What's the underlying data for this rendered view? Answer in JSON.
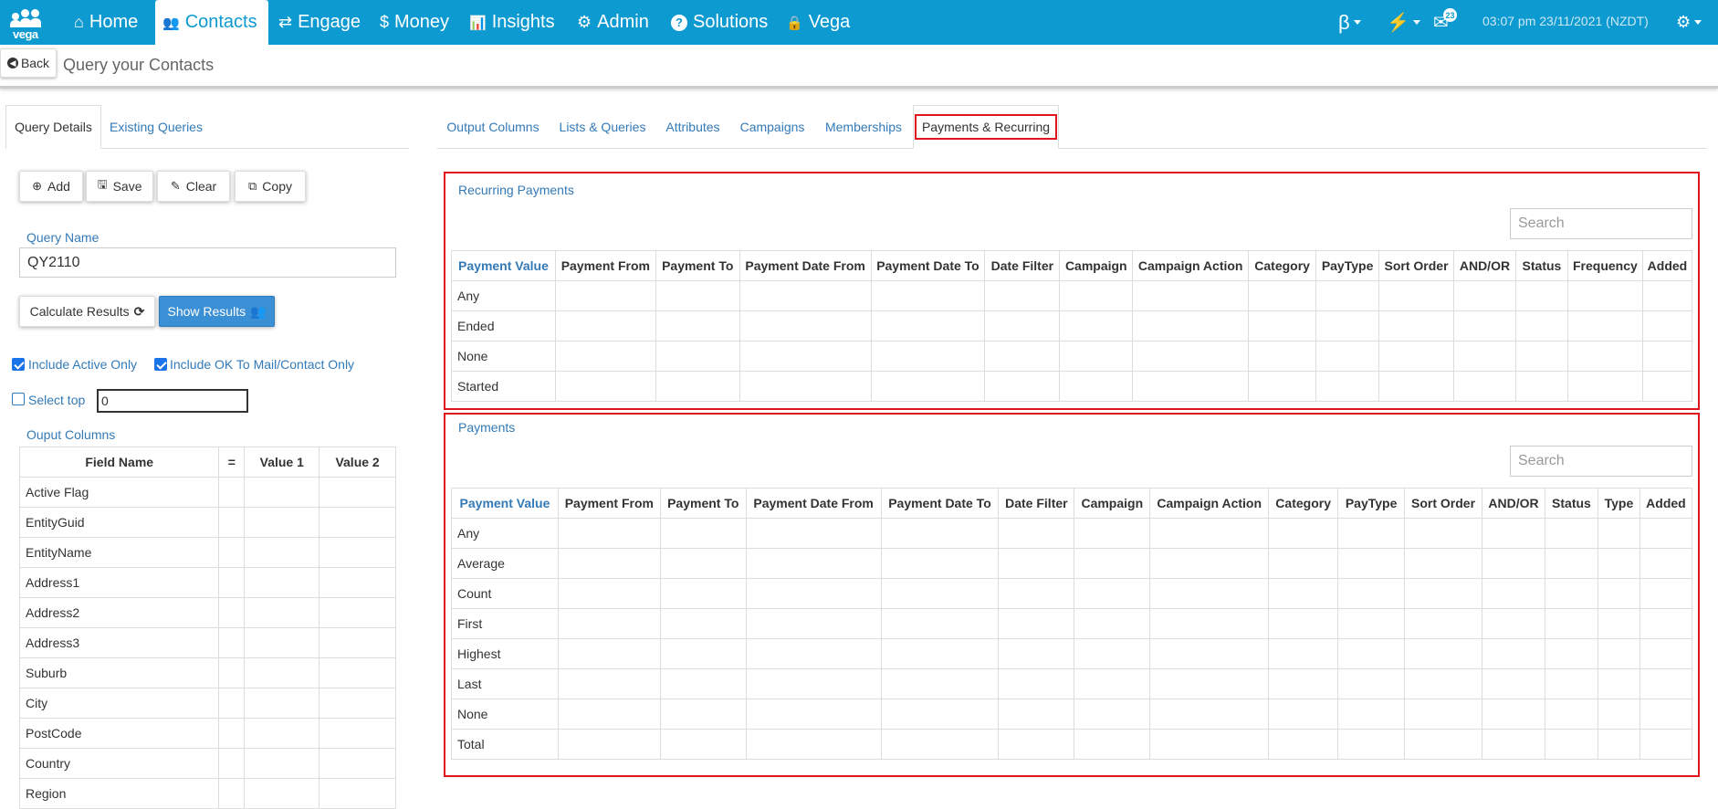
{
  "nav": {
    "logo_text": "vega",
    "items": [
      {
        "label": "Home",
        "icon": "home-icon",
        "glyph": "⌂"
      },
      {
        "label": "Contacts",
        "icon": "users-icon",
        "glyph": "👥"
      },
      {
        "label": "Engage",
        "icon": "exchange-icon",
        "glyph": "⇄"
      },
      {
        "label": "Money",
        "icon": "dollar-icon",
        "glyph": "$"
      },
      {
        "label": "Insights",
        "icon": "bar-chart-icon",
        "glyph": "📊"
      },
      {
        "label": "Admin",
        "icon": "cogs-icon",
        "glyph": "⚙"
      },
      {
        "label": "Solutions",
        "icon": "question-circle-icon",
        "glyph": "?"
      },
      {
        "label": "Vega",
        "icon": "lock-icon",
        "glyph": "🔒"
      }
    ],
    "beta_label": "β",
    "lightning_glyph": "⚡",
    "mail_glyph": "✉",
    "mail_count": "23",
    "datetime": "03:07 pm 23/11/2021 (NZDT)",
    "settings_glyph": "⚙"
  },
  "subheader": {
    "back_label": "Back",
    "page_title": "Query your Contacts"
  },
  "left_tabs": [
    "Query Details",
    "Existing Queries"
  ],
  "toolbar": {
    "add_label": "Add",
    "save_label": "Save",
    "clear_label": "Clear",
    "copy_label": "Copy"
  },
  "query": {
    "name_label": "Query Name",
    "name_value": "QY2110",
    "calculate_label": "Calculate Results",
    "show_label": "Show Results",
    "include_active_label": "Include Active Only",
    "include_ok_label": "Include OK To Mail/Contact Only",
    "select_top_label": "Select top",
    "select_top_value": "0"
  },
  "output_columns": {
    "title": "Ouput Columns",
    "headers": [
      "Field Name",
      "=",
      "Value 1",
      "Value 2"
    ],
    "rows": [
      "Active Flag",
      "EntityGuid",
      "EntityName",
      "Address1",
      "Address2",
      "Address3",
      "Suburb",
      "City",
      "PostCode",
      "Country",
      "Region"
    ]
  },
  "right_tabs": [
    "Output Columns",
    "Lists & Queries",
    "Attributes",
    "Campaigns",
    "Memberships",
    "Payments & Recurring"
  ],
  "recurring": {
    "title": "Recurring Payments",
    "search_placeholder": "Search",
    "headers": [
      "Payment Value",
      "Payment From",
      "Payment To",
      "Payment Date From",
      "Payment Date To",
      "Date Filter",
      "Campaign",
      "Campaign Action",
      "Category",
      "PayType",
      "Sort Order",
      "AND/OR",
      "Status",
      "Frequency",
      "Added"
    ],
    "rows": [
      "Any",
      "Ended",
      "None",
      "Started"
    ]
  },
  "payments": {
    "title": "Payments",
    "search_placeholder": "Search",
    "headers": [
      "Payment Value",
      "Payment From",
      "Payment To",
      "Payment Date From",
      "Payment Date To",
      "Date Filter",
      "Campaign",
      "Campaign Action",
      "Category",
      "PayType",
      "Sort Order",
      "AND/OR",
      "Status",
      "Type",
      "Added"
    ],
    "rows": [
      "Any",
      "Average",
      "Count",
      "First",
      "Highest",
      "Last",
      "None",
      "Total"
    ]
  },
  "colors": {
    "navbar": "#0d9ad1",
    "link": "#337ab7",
    "highlight": "#e0141a",
    "primary_button": "#3b8fd4"
  }
}
